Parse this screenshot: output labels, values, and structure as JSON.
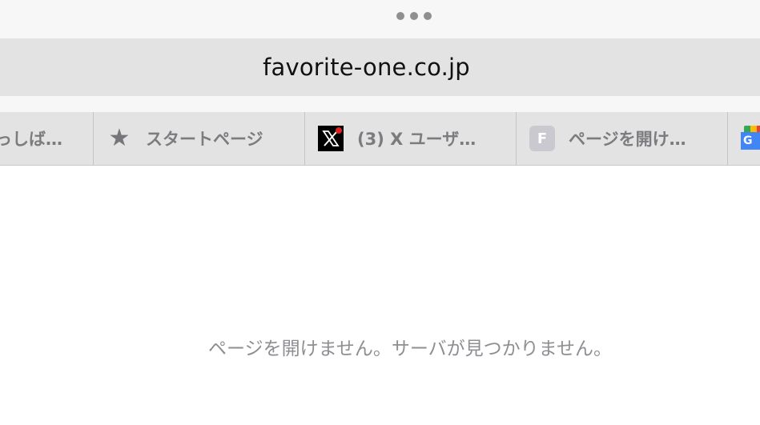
{
  "window": {
    "handle_icon": "more-dots-icon"
  },
  "address_bar": {
    "url": "favorite-one.co.jp"
  },
  "tabs": [
    {
      "label": "っしば…",
      "icon": null
    },
    {
      "label": "スタートページ",
      "icon": "star-icon"
    },
    {
      "label": "(3) X ユーザ…",
      "icon": "x-logo-icon"
    },
    {
      "label": "ページを開け…",
      "icon": "f-letter-icon",
      "icon_text": "F"
    },
    {
      "label": "",
      "icon": "google-news-icon",
      "icon_text": "G"
    }
  ],
  "main": {
    "error_message": "ページを開けません。サーバが見つかりません。"
  },
  "colors": {
    "tab_bar": "#e3e3e3",
    "chrome": "#f7f7f7",
    "tab_text": "#7c7c80",
    "error_text": "#8e8e93",
    "x_notification": "#e02020"
  }
}
